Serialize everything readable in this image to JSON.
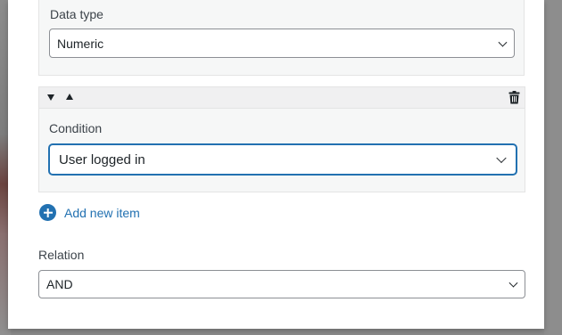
{
  "data_type": {
    "label": "Data type",
    "value": "Numeric"
  },
  "item": {
    "condition_label": "Condition",
    "condition_value": "User logged in"
  },
  "add_new_item": "Add new item",
  "relation": {
    "label": "Relation",
    "value": "AND"
  },
  "colors": {
    "accent": "#2271b1",
    "border": "#8c8f94",
    "panel_bg": "#f6f7f7"
  },
  "icons": [
    "chevron-down-icon",
    "move-down-icon",
    "move-up-icon",
    "trash-icon",
    "plus-circle-icon"
  ]
}
